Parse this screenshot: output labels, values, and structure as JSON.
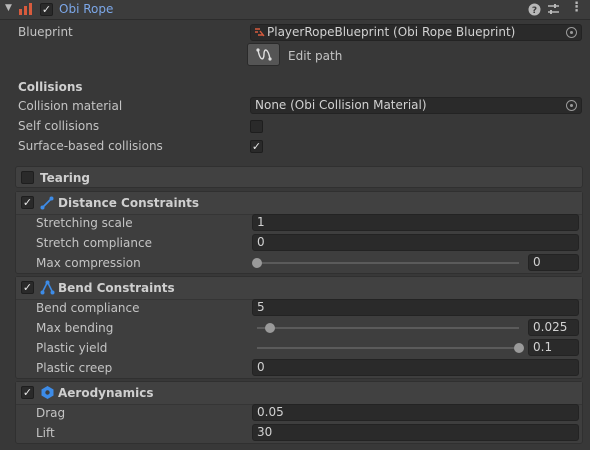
{
  "header": {
    "title": "Obi Rope",
    "enabled_mark": "✓",
    "help_icon": "help-icon",
    "settings_icon": "preset-icon",
    "menu_icon": "kebab-menu-icon",
    "accent": "#7ca7e8"
  },
  "blueprint": {
    "label": "Blueprint",
    "value": "PlayerRopeBlueprint (Obi Rope Blueprint)",
    "edit_path_label": "Edit path"
  },
  "collisions": {
    "heading": "Collisions",
    "material_label": "Collision material",
    "material_value": "None (Obi Collision Material)",
    "self_label": "Self collisions",
    "self_checked": false,
    "surface_label": "Surface-based collisions",
    "surface_checked": true,
    "check_mark": "✓"
  },
  "tearing": {
    "label": "Tearing",
    "checked": false
  },
  "distance": {
    "title": "Distance Constraints",
    "enabled": true,
    "check_mark": "✓",
    "stretching_label": "Stretching scale",
    "stretching_value": "1",
    "compliance_label": "Stretch compliance",
    "compliance_value": "0",
    "compression_label": "Max compression",
    "compression_value": "0",
    "compression_fraction": 0
  },
  "bend": {
    "title": "Bend Constraints",
    "enabled": true,
    "check_mark": "✓",
    "compliance_label": "Bend compliance",
    "compliance_value": "5",
    "max_bending_label": "Max bending",
    "max_bending_value": "0.025",
    "max_bending_fraction": 0.05,
    "plastic_yield_label": "Plastic yield",
    "plastic_yield_value": "0.1",
    "plastic_yield_fraction": 1,
    "plastic_creep_label": "Plastic creep",
    "plastic_creep_value": "0"
  },
  "aero": {
    "title": "Aerodynamics",
    "enabled": true,
    "check_mark": "✓",
    "drag_label": "Drag",
    "drag_value": "0.05",
    "lift_label": "Lift",
    "lift_value": "30"
  }
}
